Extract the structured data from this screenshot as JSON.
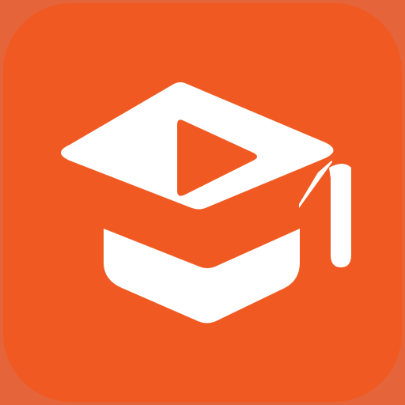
{
  "icon": {
    "name": "graduation-cap-play-icon",
    "colors": {
      "outer_background": "#E5643A",
      "tile": "#F05A22",
      "glyph": "#FFFFFF"
    }
  }
}
